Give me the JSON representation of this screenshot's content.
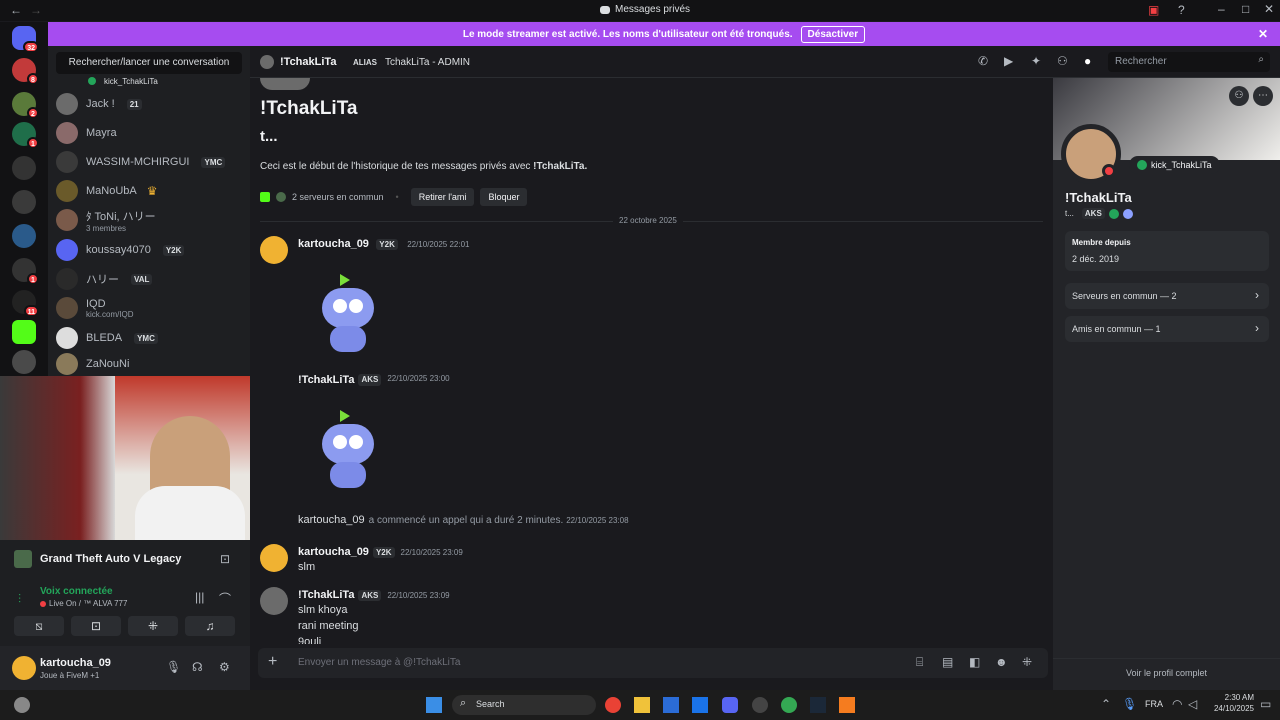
{
  "titlebar": {
    "title": "Messages privés"
  },
  "banner": {
    "text": "Le mode streamer est activé. Les noms d'utilisateur ont été tronqués.",
    "button": "Désactiver"
  },
  "rail": {
    "badges": [
      "32",
      "8",
      "2",
      "1",
      "1",
      "11"
    ]
  },
  "dm_list": {
    "search": "Rechercher/lancer une conversation",
    "items": [
      {
        "name": "kick_TchakLiTa",
        "tag": "",
        "sub": ""
      },
      {
        "name": "Jack !",
        "tag": "21",
        "sub": ""
      },
      {
        "name": "Mayra",
        "tag": "",
        "sub": ""
      },
      {
        "name": "WASSIM-MCHIRGUI",
        "tag": "YMC",
        "sub": ""
      },
      {
        "name": "MaNoUbA",
        "tag": "",
        "sub": ""
      },
      {
        "name": "ﾀ ToNi, ハリー",
        "tag": "",
        "sub": "3 membres"
      },
      {
        "name": "koussay4070",
        "tag": "Y2K",
        "sub": ""
      },
      {
        "name": "ハリー",
        "tag": "VAL",
        "sub": ""
      },
      {
        "name": "IQD",
        "tag": "",
        "sub": "kick.com/IQD"
      },
      {
        "name": "BLEDA",
        "tag": "YMC",
        "sub": ""
      },
      {
        "name": "ZaNouNi",
        "tag": "",
        "sub": ""
      }
    ]
  },
  "activity": {
    "game": "Grand Theft Auto V Legacy",
    "voice": "Voix connectée",
    "voice_sub": "Live On / ™ ALVA 777"
  },
  "user": {
    "name": "kartoucha_09",
    "status": "Joue à FiveM +1"
  },
  "header": {
    "name": "!TchakLiTa",
    "alias_label": "ALIAS",
    "alias": "TchakLiTa - ADMIN",
    "search": "Rechercher"
  },
  "chat": {
    "title": "!TchakLiTa",
    "subtitle": "t...",
    "intro": "Ceci est le début de l'historique de tes messages privés avec",
    "intro_name": "!TchakLiTa.",
    "common": "2 serveurs en commun",
    "remove": "Retirer l'ami",
    "block": "Bloquer",
    "date_divider": "22 octobre 2025",
    "messages": [
      {
        "author": "kartoucha_09",
        "tag": "Y2K",
        "time": "22/10/2025 22:01"
      },
      {
        "author": "!TchakLiTa",
        "tag": "AKS",
        "time": "22/10/2025 23:00"
      },
      {
        "author": "kartoucha_09",
        "call": "a commencé un appel qui a duré 2 minutes.",
        "time": "22/10/2025 23:08"
      },
      {
        "author": "kartoucha_09",
        "tag": "Y2K",
        "time": "22/10/2025 23:09",
        "lines": [
          "slm"
        ]
      },
      {
        "author": "!TchakLiTa",
        "tag": "AKS",
        "time": "22/10/2025 23:09",
        "lines": [
          "slm khoya",
          "rani meeting",
          "9ouli"
        ]
      }
    ],
    "composer": "Envoyer un message à @!TchakLiTa"
  },
  "profile": {
    "name": "!TchakLiTa",
    "handle": "t...",
    "tag": "AKS",
    "status": "kick_TchakLiTa",
    "member_since_label": "Membre depuis",
    "member_since": "2 déc. 2019",
    "servers": "Serveurs en commun — 2",
    "friends": "Amis en commun — 1",
    "full": "Voir le profil complet"
  },
  "taskbar": {
    "search": "Search",
    "lang": "FRA",
    "time": "2:30 AM",
    "date": "24/10/2025"
  },
  "colors": {
    "accent": "#5865f2",
    "banner": "#a64cf0",
    "online": "#23a55a",
    "danger": "#f23f43"
  }
}
